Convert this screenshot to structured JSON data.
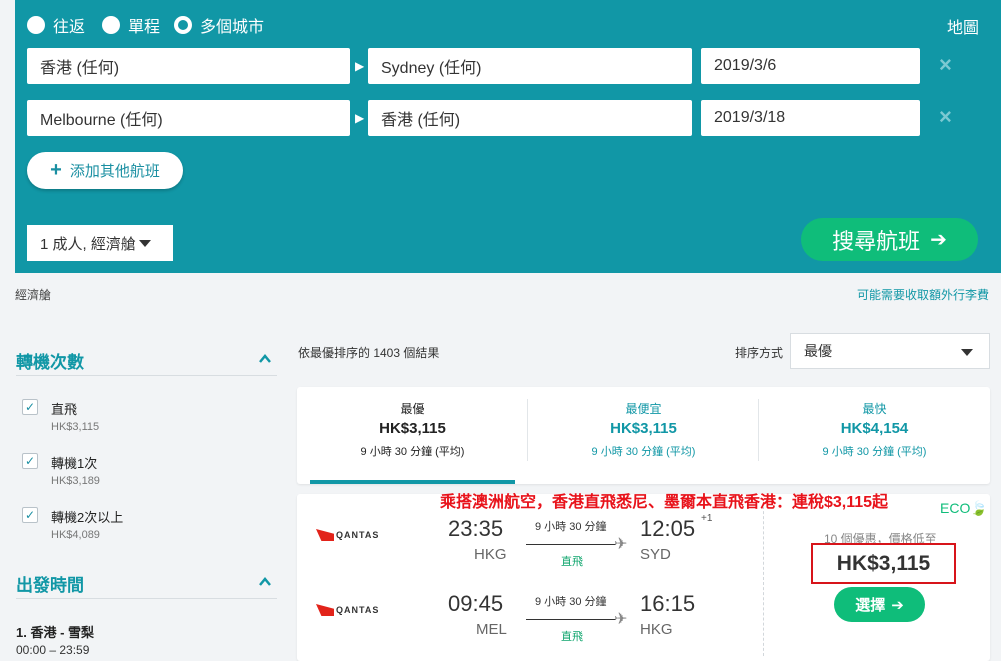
{
  "search": {
    "trip_types": [
      {
        "label": "往返",
        "selected": false
      },
      {
        "label": "單程",
        "selected": false
      },
      {
        "label": "多個城市",
        "selected": true
      }
    ],
    "map_link": "地圖",
    "legs": [
      {
        "from": "香港 (任何)",
        "to": "Sydney (任何)",
        "date": "2019/3/6"
      },
      {
        "from": "Melbourne (任何)",
        "to": "香港 (任何)",
        "date": "2019/3/18"
      }
    ],
    "remove_icon": "×",
    "add_flight_label": "添加其他航班",
    "passengers_label": "1 成人, 經濟艙",
    "search_button_label": "搜尋航班"
  },
  "cabin_note": "經濟艙",
  "extra_fee_link": "可能需要收取額外行李費",
  "sidebar": {
    "stops_title": "轉機次數",
    "stops": [
      {
        "label": "直飛",
        "price": "HK$3,115",
        "checked": true
      },
      {
        "label": "轉機1次",
        "price": "HK$3,189",
        "checked": true
      },
      {
        "label": "轉機2次以上",
        "price": "HK$4,089",
        "checked": true
      }
    ],
    "departure_title": "出發時間",
    "route_label": "1. 香港 - 雪梨",
    "route_time": "00:00 – 23:59"
  },
  "results": {
    "count_text": "依最優排序的 1403 個結果",
    "sort_label": "排序方式",
    "sort_value": "最優",
    "tabs": [
      {
        "name": "最優",
        "price": "HK$3,115",
        "duration": "9 小時 30 分鐘 (平均)",
        "active": true
      },
      {
        "name": "最便宜",
        "price": "HK$3,115",
        "duration": "9 小時 30 分鐘 (平均)",
        "active": false
      },
      {
        "name": "最快",
        "price": "HK$4,154",
        "duration": "9 小時 30 分鐘 (平均)",
        "active": false
      }
    ]
  },
  "card": {
    "promo_text": "乘搭澳洲航空，香港直飛悉尼、墨爾本直飛香港：連稅$3,115起",
    "eco_label": "ECO",
    "deals_text": "10 個優惠，價格低至",
    "price": "HK$3,115",
    "select_label": "選擇",
    "legs": [
      {
        "airline": "QANTAS",
        "dep_time": "23:35",
        "dep_airport": "HKG",
        "duration": "9 小時 30 分鐘",
        "stops": "直飛",
        "arr_time": "12:05",
        "arr_plus": "+1",
        "arr_airport": "SYD"
      },
      {
        "airline": "QANTAS",
        "dep_time": "09:45",
        "dep_airport": "MEL",
        "duration": "9 小時 30 分鐘",
        "stops": "直飛",
        "arr_time": "16:15",
        "arr_plus": "",
        "arr_airport": "HKG"
      }
    ]
  },
  "colors": {
    "panel": "#1197a6",
    "accent_green": "#0fbd7a",
    "promo_red": "#e8131b"
  }
}
